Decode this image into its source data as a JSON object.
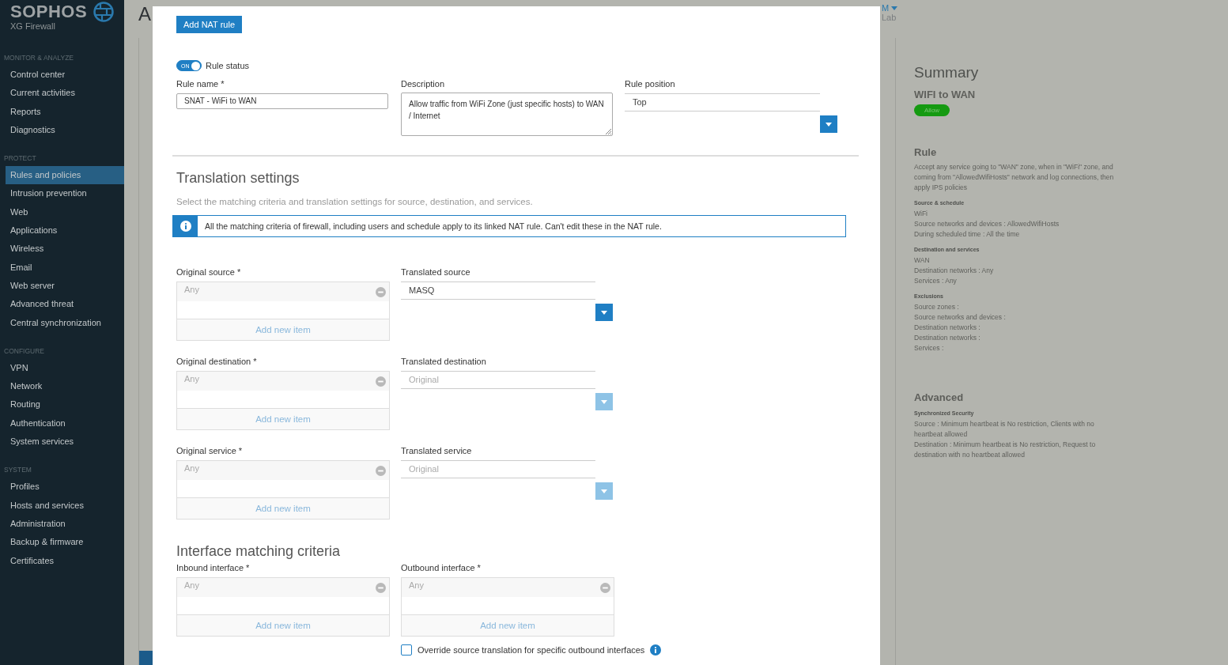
{
  "sidebar": {
    "logo": {
      "name": "SOPHOS",
      "subtitle": "XG Firewall"
    },
    "sections": [
      {
        "title": "MONITOR & ANALYZE",
        "items": [
          {
            "label": "Control center",
            "selected": false
          },
          {
            "label": "Current activities",
            "selected": false
          },
          {
            "label": "Reports",
            "selected": false
          },
          {
            "label": "Diagnostics",
            "selected": false
          }
        ]
      },
      {
        "title": "PROTECT",
        "items": [
          {
            "label": "Rules and policies",
            "selected": true
          },
          {
            "label": "Intrusion prevention",
            "selected": false
          },
          {
            "label": "Web",
            "selected": false
          },
          {
            "label": "Applications",
            "selected": false
          },
          {
            "label": "Wireless",
            "selected": false
          },
          {
            "label": "Email",
            "selected": false
          },
          {
            "label": "Web server",
            "selected": false
          },
          {
            "label": "Advanced threat",
            "selected": false
          },
          {
            "label": "Central synchronization",
            "selected": false
          }
        ]
      },
      {
        "title": "CONFIGURE",
        "items": [
          {
            "label": "VPN",
            "selected": false
          },
          {
            "label": "Network",
            "selected": false
          },
          {
            "label": "Routing",
            "selected": false
          },
          {
            "label": "Authentication",
            "selected": false
          },
          {
            "label": "System services",
            "selected": false
          }
        ]
      },
      {
        "title": "SYSTEM",
        "items": [
          {
            "label": "Profiles",
            "selected": false
          },
          {
            "label": "Hosts and services",
            "selected": false
          },
          {
            "label": "Administration",
            "selected": false
          },
          {
            "label": "Backup & firmware",
            "selected": false
          },
          {
            "label": "Certificates",
            "selected": false
          }
        ]
      }
    ]
  },
  "header": {
    "title": "A",
    "user": "M",
    "org": "Lab"
  },
  "summary": {
    "title": "Summary",
    "rule_name": "WIFI to WAN",
    "action": "Allow",
    "sections": [
      {
        "heading": "Rule",
        "text": "Accept any service going to \"WAN\" zone, when in \"WiFi\" zone, and coming from \"AllowedWifiHosts\" network and log connections, then apply IPS policies",
        "groups": [
          {
            "title": "Source & schedule",
            "lines": [
              "WiFi",
              "Source networks and devices : AllowedWifiHosts",
              "During scheduled time : All the time"
            ]
          },
          {
            "title": "Destination and services",
            "lines": [
              "WAN",
              "Destination networks : Any",
              "Services : Any"
            ]
          },
          {
            "title": "Exclusions",
            "lines": [
              "Source zones :",
              "Source networks and devices :",
              "Destination networks :",
              "Destination networks :",
              "Services :"
            ]
          }
        ]
      },
      {
        "heading": "Advanced",
        "groups": [
          {
            "title": "Synchronized Security",
            "lines": [
              "Source : Minimum heartbeat is No restriction, Clients with no heartbeat allowed",
              "Destination : Minimum heartbeat is No restriction, Request to destination with no heartbeat allowed"
            ]
          }
        ]
      }
    ]
  },
  "modal": {
    "add_button": "Add NAT rule",
    "rule_status": {
      "label": "Rule status",
      "toggle_text": "ON",
      "on": true
    },
    "rule_name": {
      "label": "Rule name *",
      "value": "SNAT - WiFi to WAN"
    },
    "description": {
      "label": "Description",
      "value": "Allow traffic from WiFi Zone (just specific hosts) to WAN / Internet"
    },
    "rule_position": {
      "label": "Rule position",
      "value": "Top"
    },
    "translation": {
      "title": "Translation settings",
      "subtitle": "Select the matching criteria and translation settings for source, destination, and services.",
      "info": "All the matching criteria of firewall, including users and schedule apply to its linked NAT rule. Can't edit these in the NAT rule.",
      "rows": [
        {
          "original": {
            "label": "Original source *",
            "placeholder": "Any",
            "add": "Add new item"
          },
          "translated": {
            "label": "Translated source",
            "value": "MASQ",
            "disabled": false
          }
        },
        {
          "original": {
            "label": "Original destination *",
            "placeholder": "Any",
            "add": "Add new item"
          },
          "translated": {
            "label": "Translated destination",
            "value": "Original",
            "disabled": true
          }
        },
        {
          "original": {
            "label": "Original service *",
            "placeholder": "Any",
            "add": "Add new item"
          },
          "translated": {
            "label": "Translated service",
            "value": "Original",
            "disabled": true
          }
        }
      ]
    },
    "interface": {
      "title": "Interface matching criteria",
      "pickers": [
        {
          "label": "Inbound interface *",
          "placeholder": "Any",
          "add": "Add new item"
        },
        {
          "label": "Outbound interface *",
          "placeholder": "Any",
          "add": "Add new item"
        }
      ],
      "override": {
        "label": "Override source translation for specific outbound interfaces",
        "checked": false
      }
    }
  }
}
